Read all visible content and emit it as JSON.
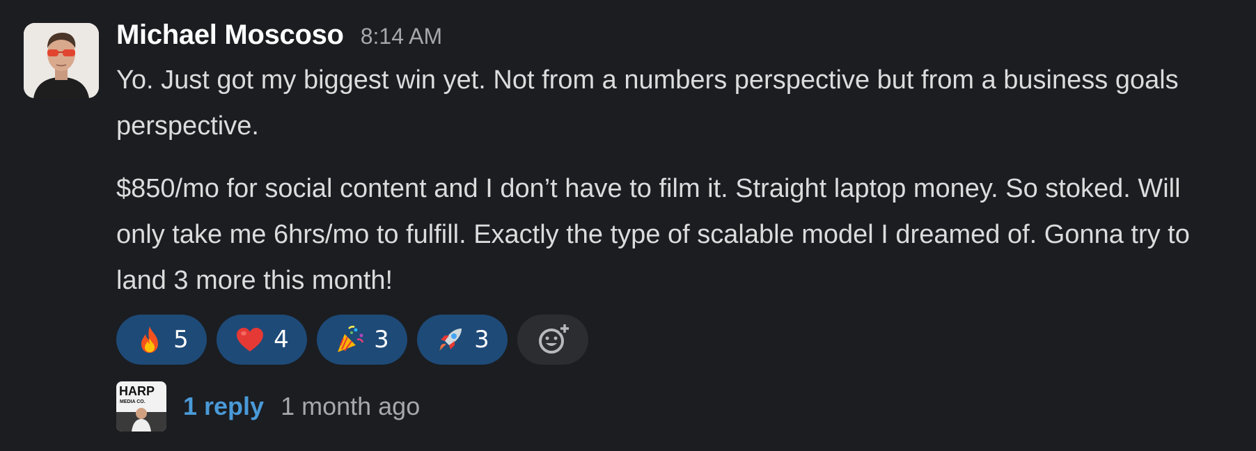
{
  "message": {
    "sender": "Michael Moscoso",
    "timestamp": "8:14 AM",
    "paragraphs": [
      "Yo. Just got my biggest win yet. Not from a numbers perspective but from a business goals perspective.",
      "$850/mo for social content and I don’t have to film it. Straight laptop money. So stoked. Will only take me 6hrs/mo to fulfill. Exactly the type of scalable model I dreamed of. Gonna try to land 3 more this month!"
    ]
  },
  "reactions": [
    {
      "icon": "fire-icon",
      "count": "5"
    },
    {
      "icon": "heart-icon",
      "count": "4"
    },
    {
      "icon": "party-popper-icon",
      "count": "3"
    },
    {
      "icon": "rocket-icon",
      "count": "3"
    }
  ],
  "thread": {
    "avatar_text_line1": "HARP",
    "avatar_text_line2": "MEDIA CO.",
    "reply_label": "1 reply",
    "reply_time": "1 month ago"
  },
  "colors": {
    "background": "#1b1d21",
    "reaction_bg": "#1e4a77",
    "link": "#4a9ad8"
  }
}
